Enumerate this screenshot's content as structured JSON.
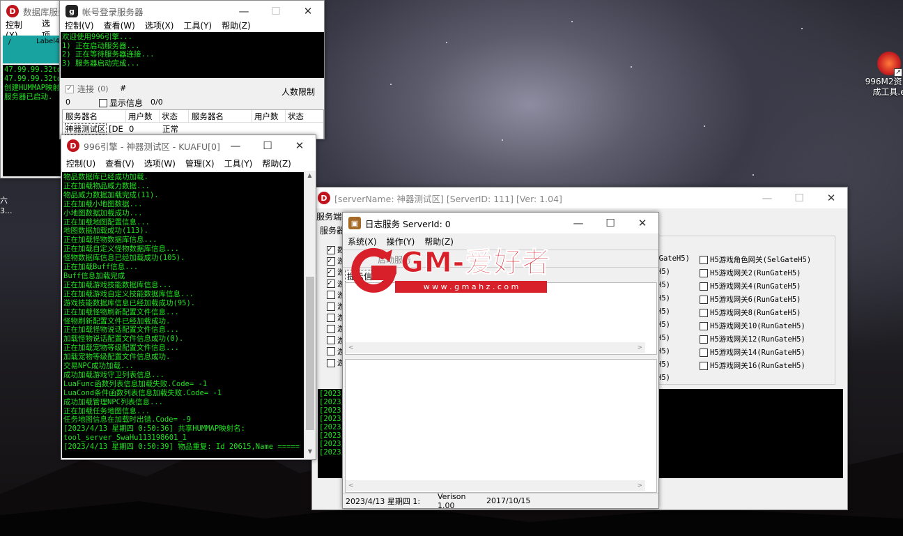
{
  "desktop": {
    "icon_label": "996M2资 集成工具.e",
    "side_text_1": "六",
    "side_text_2": "3..."
  },
  "db_window": {
    "title": "数据库服务",
    "menu": [
      "控制(X)",
      "选项"
    ],
    "grid_slash": "/",
    "grid_label": "Label4",
    "log": [
      "47.99.99.32to",
      "47.99.99.32to",
      "创建HUMMAP映射",
      "服务器已启动."
    ]
  },
  "login_window": {
    "title": "帐号登录服务器",
    "menu": [
      "控制(V)",
      "查看(W)",
      "选项(X)",
      "工具(Y)",
      "帮助(Z)"
    ],
    "log": [
      "欢迎使用996引擎...",
      "1) 正在启动服务器...",
      "2) 正在等待服务器连接...",
      "3) 服务器启动完成..."
    ],
    "connect_label": "连接",
    "connect_count": "(0)",
    "hash": "#",
    "limit_label": "人数限制",
    "count_value": "0",
    "show_info_label": "显示信息",
    "ratio": "0/0",
    "columns": [
      "服务器名",
      "用户数",
      "状态",
      "服务器名",
      "用户数",
      "状态"
    ],
    "row": {
      "name": "神器测试区",
      "tag": "[DE",
      "users": "0",
      "status": "正常"
    }
  },
  "engine_window": {
    "title": "996引擎 - 神器测试区 - KUAFU[0]",
    "menu": [
      "控制(U)",
      "查看(V)",
      "选项(W)",
      "管理(X)",
      "工具(Y)",
      "帮助(Z)"
    ],
    "log": [
      "物品数据库已经成功加载.",
      "正在加载物品威力数据...",
      "物品威力数据加载完成(11).",
      "正在加载小地图数据...",
      "小地图数据加载成功...",
      "正在加载地图配置信息...",
      "地图数据加载成功(113).",
      "正在加载怪物数据库信息...",
      "正在加载自定义怪物数据库信息...",
      "怪物数据库信息已经加载成功(105).",
      "正在加载Buff信息...",
      "Buff信息加载完成",
      "正在加载游戏技能数据库信息...",
      "正在加载游戏自定义技能数据库信息...",
      "游戏技能数据库信息已经加载成功(95).",
      "正在加载怪物刷新配置文件信息...",
      "怪物刷新配置文件已经加载成功.",
      "正在加载怪物说话配置文件信息...",
      "加载怪物说话配置文件信息成功(0).",
      "正在加载宠物等级配置文件信息...",
      "加载宠物等级配置文件信息成功.",
      "交易NPC成功加载...",
      "成功加载游戏守卫列表信息...",
      "LuaFunc函数列表信息加载失败.Code= -1",
      "LuaCond条件函数列表信息加载失败.Code= -1",
      "成功加载管理NPC列表信息...",
      "正在加载任务地图信息...",
      "任务地图信息在加载时出错.Code= -9",
      "[2023/4/13 星期四 0:50:36] 共享HUMMAP映射名:",
      "tool_server_SwaHu113198601_1",
      "[2023/4/13 星期四 0:50:39] 物品重复: Id 20615,Name ====="
    ]
  },
  "server_window": {
    "title": "[serverName: 神器测试区] [ServerID: 111] [Ver: 1.04]",
    "tab": "服务端控",
    "label": "服务器",
    "left_items": [
      "数",
      "游",
      "游",
      "游",
      "游",
      "游",
      "游",
      "游",
      "游",
      "游",
      "游"
    ],
    "mid_items": [
      "unGateH5)",
      "H5)",
      "H5)",
      "H5)",
      "H5)",
      "H5)",
      "H5)",
      "H5)",
      "H5)",
      "H5)"
    ],
    "right_items": [
      "H5游戏角色网关(SelGateH5)",
      "H5游戏网关2(RunGateH5)",
      "H5游戏网关4(RunGateH5)",
      "H5游戏网关6(RunGateH5)",
      "H5游戏网关8(RunGateH5)",
      "H5游戏网关10(RunGateH5)",
      "H5游戏网关12(RunGateH5)",
      "H5游戏网关14(RunGateH5)",
      "H5游戏网关16(RunGateH5)"
    ],
    "log": [
      "[2023/",
      "[2023/",
      "[2023/",
      "[2023/",
      "[2023/",
      "[2023/",
      "[2023/",
      "[2023/"
    ]
  },
  "log_window": {
    "title": "日志服务 ServerId: 0",
    "menu": [
      "系统(X)",
      "操作(Y)",
      "帮助(Z)"
    ],
    "toolbar_btn": "启动服务",
    "tab": "提示信息",
    "status_date": "2023/4/13 星期四 1:",
    "status_version": "Verison 1.00",
    "status_build": "2017/10/15"
  },
  "watermark": {
    "brand": "GM-爱好者",
    "url": "w w w . g m a h z . c o m"
  },
  "colors": {
    "terminal_text": "#21e021",
    "terminal_bg": "#000000",
    "brand_red": "#d8202a",
    "db_header": "#19a3a0"
  }
}
